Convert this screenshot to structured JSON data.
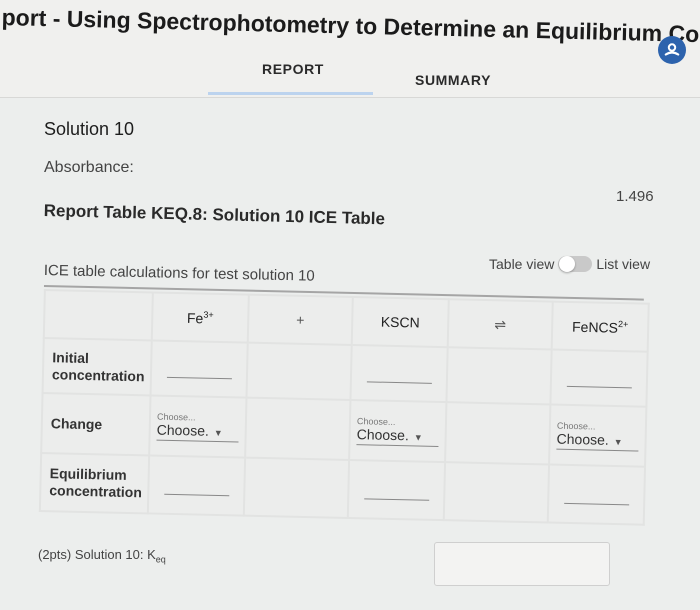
{
  "header": {
    "title": "port - Using Spectrophotometry to Determine an Equilibrium Co...",
    "tabs": [
      {
        "label": "REPORT",
        "active": true
      },
      {
        "label": "SUMMARY",
        "active": false
      }
    ],
    "avatar_icon": "user-icon",
    "accent_color": "#2d63ad"
  },
  "solution": {
    "title": "Solution 10",
    "absorbance_label": "Absorbance:",
    "absorbance_value": "1.496"
  },
  "report_table": {
    "title": "Report Table KEQ.8: Solution 10 ICE Table",
    "view_toggle": {
      "left_label": "Table view",
      "right_label": "List view"
    },
    "caption": "ICE table calculations for test solution 10",
    "columns": {
      "reactant1": {
        "base": "Fe",
        "charge": "3+"
      },
      "plus": "+",
      "reactant2": "KSCN",
      "arrow": "⇌",
      "product": {
        "base": "FeNCS",
        "charge": "2+"
      }
    },
    "rows": [
      {
        "label": "Initial concentration"
      },
      {
        "label": "Change",
        "select_small": "Choose...",
        "select_value": "Choose."
      },
      {
        "label": "Equilibrium concentration"
      }
    ]
  },
  "keq": {
    "prefix": "(2pts) Solution 10: K",
    "subscript": "eq"
  }
}
